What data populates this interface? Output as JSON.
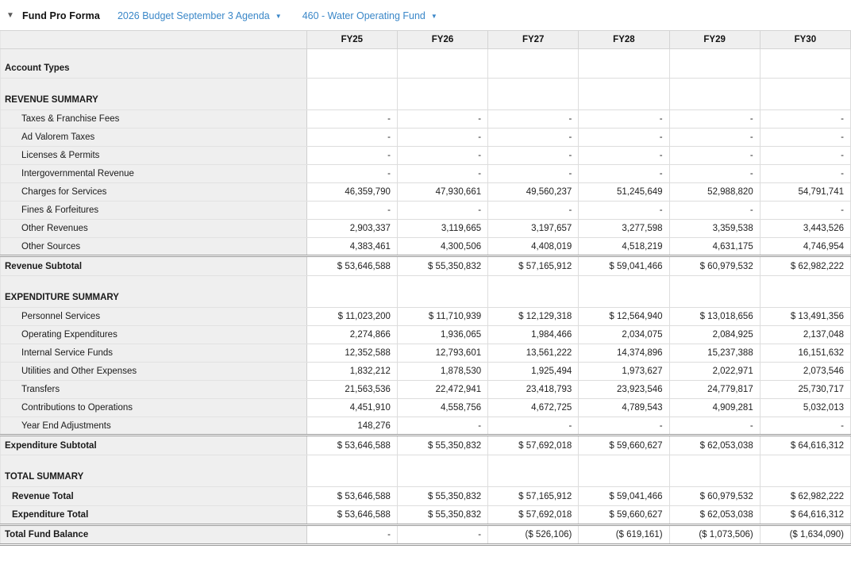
{
  "header": {
    "collapse_icon": "▼",
    "title": "Fund Pro Forma",
    "budget_dropdown": "2026 Budget September 3 Agenda",
    "fund_dropdown": "460 - Water Operating Fund",
    "dropdown_arrow": "▼",
    "link_color": "#3a87c8"
  },
  "table": {
    "columns": [
      "FY25",
      "FY26",
      "FY27",
      "FY28",
      "FY29",
      "FY30"
    ],
    "rows": [
      {
        "type": "section",
        "label": "Account Types",
        "values": [
          "",
          "",
          "",
          "",
          "",
          ""
        ]
      },
      {
        "type": "section",
        "label": "REVENUE SUMMARY",
        "values": [
          "",
          "",
          "",
          "",
          "",
          ""
        ]
      },
      {
        "type": "data",
        "label": "Taxes & Franchise Fees",
        "values": [
          "-",
          "-",
          "-",
          "-",
          "-",
          "-"
        ]
      },
      {
        "type": "data",
        "label": "Ad Valorem Taxes",
        "values": [
          "-",
          "-",
          "-",
          "-",
          "-",
          "-"
        ]
      },
      {
        "type": "data",
        "label": "Licenses & Permits",
        "values": [
          "-",
          "-",
          "-",
          "-",
          "-",
          "-"
        ]
      },
      {
        "type": "data",
        "label": "Intergovernmental Revenue",
        "values": [
          "-",
          "-",
          "-",
          "-",
          "-",
          "-"
        ]
      },
      {
        "type": "data",
        "label": "Charges for Services",
        "values": [
          "46,359,790",
          "47,930,661",
          "49,560,237",
          "51,245,649",
          "52,988,820",
          "54,791,741"
        ]
      },
      {
        "type": "data",
        "label": "Fines & Forfeitures",
        "values": [
          "-",
          "-",
          "-",
          "-",
          "-",
          "-"
        ]
      },
      {
        "type": "data",
        "label": "Other Revenues",
        "values": [
          "2,903,337",
          "3,119,665",
          "3,197,657",
          "3,277,598",
          "3,359,538",
          "3,443,526"
        ]
      },
      {
        "type": "data",
        "label": "Other Sources",
        "values": [
          "4,383,461",
          "4,300,506",
          "4,408,019",
          "4,518,219",
          "4,631,175",
          "4,746,954"
        ]
      },
      {
        "type": "subtotal",
        "label": "Revenue Subtotal",
        "values": [
          "$ 53,646,588",
          "$ 55,350,832",
          "$ 57,165,912",
          "$ 59,041,466",
          "$ 60,979,532",
          "$ 62,982,222"
        ]
      },
      {
        "type": "section",
        "label": "EXPENDITURE SUMMARY",
        "values": [
          "",
          "",
          "",
          "",
          "",
          ""
        ]
      },
      {
        "type": "data",
        "label": "Personnel Services",
        "values": [
          "$ 11,023,200",
          "$ 11,710,939",
          "$ 12,129,318",
          "$ 12,564,940",
          "$ 13,018,656",
          "$ 13,491,356"
        ]
      },
      {
        "type": "data",
        "label": "Operating Expenditures",
        "values": [
          "2,274,866",
          "1,936,065",
          "1,984,466",
          "2,034,075",
          "2,084,925",
          "2,137,048"
        ]
      },
      {
        "type": "data",
        "label": "Internal Service Funds",
        "values": [
          "12,352,588",
          "12,793,601",
          "13,561,222",
          "14,374,896",
          "15,237,388",
          "16,151,632"
        ]
      },
      {
        "type": "data",
        "label": "Utilities and Other Expenses",
        "values": [
          "1,832,212",
          "1,878,530",
          "1,925,494",
          "1,973,627",
          "2,022,971",
          "2,073,546"
        ]
      },
      {
        "type": "data",
        "label": "Transfers",
        "values": [
          "21,563,536",
          "22,472,941",
          "23,418,793",
          "23,923,546",
          "24,779,817",
          "25,730,717"
        ]
      },
      {
        "type": "data",
        "label": "Contributions to Operations",
        "values": [
          "4,451,910",
          "4,558,756",
          "4,672,725",
          "4,789,543",
          "4,909,281",
          "5,032,013"
        ]
      },
      {
        "type": "data",
        "label": "Year End Adjustments",
        "values": [
          "148,276",
          "-",
          "-",
          "-",
          "-",
          "-"
        ]
      },
      {
        "type": "subtotal",
        "label": "Expenditure Subtotal",
        "values": [
          "$ 53,646,588",
          "$ 55,350,832",
          "$ 57,692,018",
          "$ 59,660,627",
          "$ 62,053,038",
          "$ 64,616,312"
        ]
      },
      {
        "type": "section",
        "label": "TOTAL SUMMARY",
        "values": [
          "",
          "",
          "",
          "",
          "",
          ""
        ]
      },
      {
        "type": "totalline",
        "label": "Revenue Total",
        "values": [
          "$ 53,646,588",
          "$ 55,350,832",
          "$ 57,165,912",
          "$ 59,041,466",
          "$ 60,979,532",
          "$ 62,982,222"
        ]
      },
      {
        "type": "totalline",
        "label": "Expenditure Total",
        "values": [
          "$ 53,646,588",
          "$ 55,350,832",
          "$ 57,692,018",
          "$ 59,660,627",
          "$ 62,053,038",
          "$ 64,616,312"
        ]
      },
      {
        "type": "grandtotal",
        "label": "Total Fund Balance",
        "values": [
          "-",
          "-",
          "($ 526,106)",
          "($ 619,161)",
          "($ 1,073,506)",
          "($ 1,634,090)"
        ]
      }
    ]
  }
}
